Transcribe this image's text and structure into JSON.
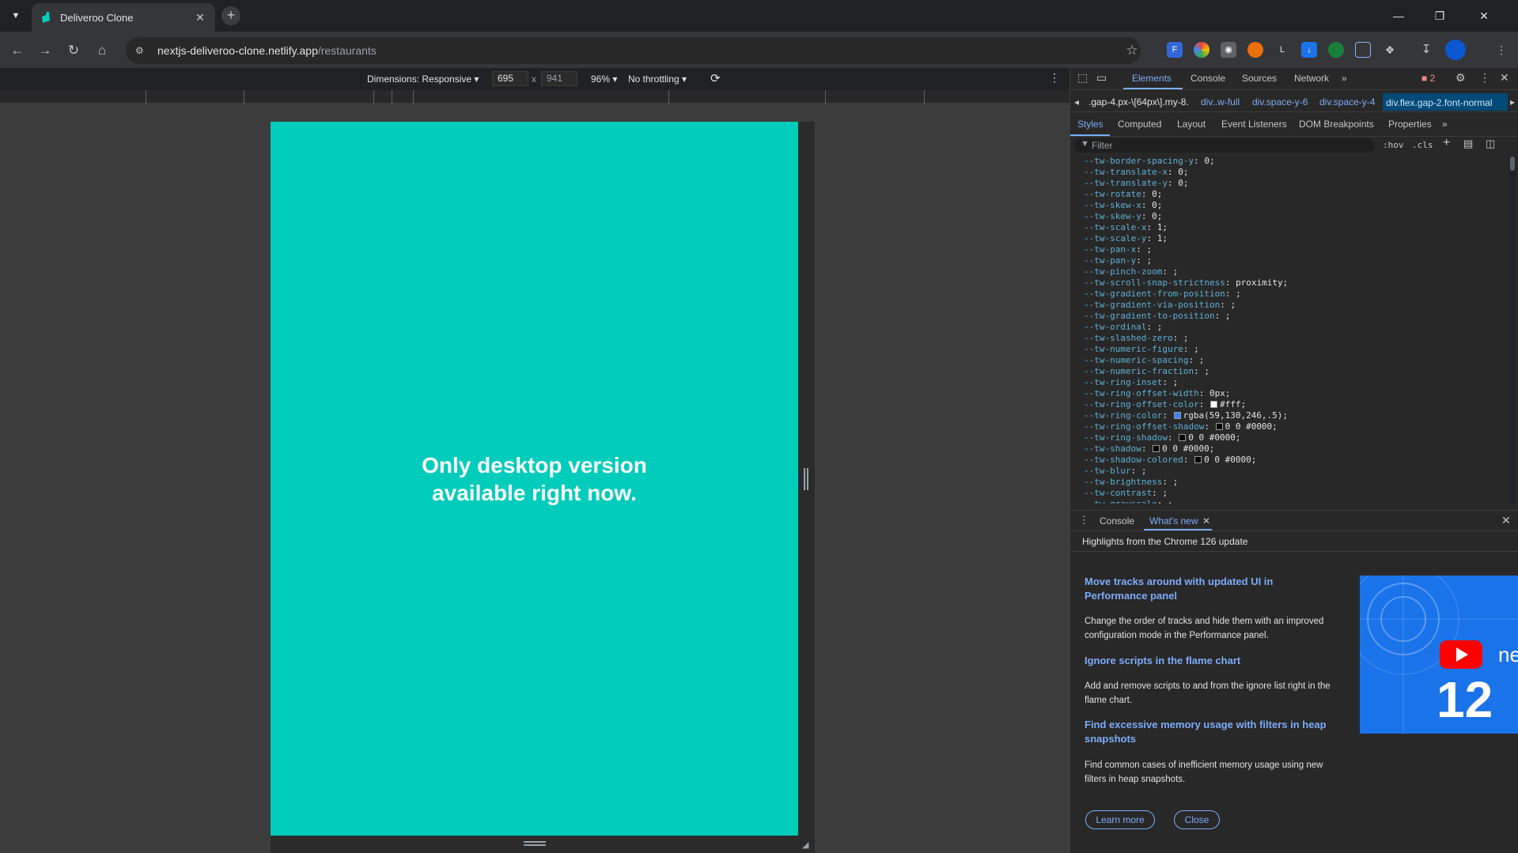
{
  "browser": {
    "tab_title": "Deliveroo Clone",
    "url_host": "nextjs-deliveroo-clone.netlify.app",
    "url_path": "/restaurants"
  },
  "device_toolbar": {
    "dimensions_label": "Dimensions: Responsive",
    "width": "695",
    "height": "941",
    "zoom": "96%",
    "throttling": "No throttling",
    "times": "x"
  },
  "page": {
    "message": "Only desktop version available right now.",
    "background": "#00ccbc"
  },
  "devtools": {
    "tabs": [
      "Elements",
      "Console",
      "Sources",
      "Network"
    ],
    "issues_count": "2",
    "breadcrumbs": [
      ".gap-4.px-\\[64px\\].my-8.",
      "div..w-full",
      "div.space-y-6",
      "div.space-y-4",
      "div.flex.gap-2.font-normal"
    ],
    "sub_tabs": [
      "Styles",
      "Computed",
      "Layout",
      "Event Listeners",
      "DOM Breakpoints",
      "Properties"
    ],
    "filter_placeholder": "Filter",
    "hov": ":hov",
    "cls": ".cls",
    "css_vars": [
      {
        "prop": "--tw-border-spacing-y",
        "val": "0;"
      },
      {
        "prop": "--tw-translate-x",
        "val": "0;"
      },
      {
        "prop": "--tw-translate-y",
        "val": "0;"
      },
      {
        "prop": "--tw-rotate",
        "val": "0;"
      },
      {
        "prop": "--tw-skew-x",
        "val": "0;"
      },
      {
        "prop": "--tw-skew-y",
        "val": "0;"
      },
      {
        "prop": "--tw-scale-x",
        "val": "1;"
      },
      {
        "prop": "--tw-scale-y",
        "val": "1;"
      },
      {
        "prop": "--tw-pan-x",
        "val": ";"
      },
      {
        "prop": "--tw-pan-y",
        "val": ";"
      },
      {
        "prop": "--tw-pinch-zoom",
        "val": ";"
      },
      {
        "prop": "--tw-scroll-snap-strictness",
        "val": "proximity;"
      },
      {
        "prop": "--tw-gradient-from-position",
        "val": ";"
      },
      {
        "prop": "--tw-gradient-via-position",
        "val": ";"
      },
      {
        "prop": "--tw-gradient-to-position",
        "val": ";"
      },
      {
        "prop": "--tw-ordinal",
        "val": ";"
      },
      {
        "prop": "--tw-slashed-zero",
        "val": ";"
      },
      {
        "prop": "--tw-numeric-figure",
        "val": ";"
      },
      {
        "prop": "--tw-numeric-spacing",
        "val": ";"
      },
      {
        "prop": "--tw-numeric-fraction",
        "val": ";"
      },
      {
        "prop": "--tw-ring-inset",
        "val": ";"
      },
      {
        "prop": "--tw-ring-offset-width",
        "val": "0px;"
      },
      {
        "prop": "--tw-ring-offset-color",
        "val": "#fff;",
        "swatch": "#ffffff"
      },
      {
        "prop": "--tw-ring-color",
        "val": "rgba(59,130,246,.5);",
        "swatch": "#3b82f6"
      },
      {
        "prop": "--tw-ring-offset-shadow",
        "val": "0 0 #0000;",
        "swatch": "#000000"
      },
      {
        "prop": "--tw-ring-shadow",
        "val": "0 0 #0000;",
        "swatch": "#000000"
      },
      {
        "prop": "--tw-shadow",
        "val": "0 0 #0000;",
        "swatch": "#000000"
      },
      {
        "prop": "--tw-shadow-colored",
        "val": "0 0 #0000;",
        "swatch": "#000000"
      },
      {
        "prop": "--tw-blur",
        "val": ";"
      },
      {
        "prop": "--tw-brightness",
        "val": ";"
      },
      {
        "prop": "--tw-contrast",
        "val": ";"
      },
      {
        "prop": "--tw-grayscale",
        "val": ";"
      }
    ],
    "drawer": {
      "tabs": [
        "Console",
        "What's new"
      ],
      "highlight": "Highlights from the Chrome 126 update",
      "items": [
        {
          "title": "Move tracks around with updated UI in Performance panel",
          "body": "Change the order of tracks and hide them with an improved configuration mode in the Performance panel."
        },
        {
          "title": "Ignore scripts in the flame chart",
          "body": "Add and remove scripts to and from the ignore list right in the flame chart."
        },
        {
          "title": "Find excessive memory usage with filters in heap snapshots",
          "body": "Find common cases of inefficient memory usage using new filters in heap snapshots."
        }
      ],
      "video_text": "12",
      "video_text2": "ne",
      "learn_more": "Learn more",
      "close": "Close"
    }
  }
}
